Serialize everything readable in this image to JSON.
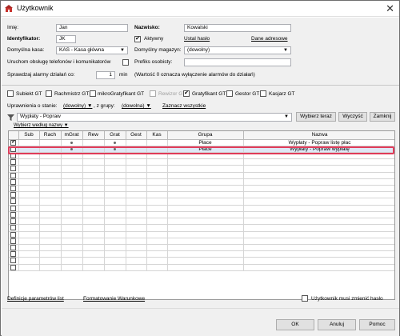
{
  "window": {
    "title": "Użytkownik",
    "close_glyph": "✕"
  },
  "form": {
    "imie_label": "Imię:",
    "imie_value": "Jan",
    "nazwisko_label": "Nazwisko:",
    "nazwisko_value": "Kowalski",
    "identyfikator_label": "Identyfikator:",
    "identyfikator_value": "JK",
    "aktywny_label": "Aktywny",
    "aktywny_checked": "✔",
    "ustal_haslo": "Ustal hasło",
    "dane_adresowe": "Dane adresowe",
    "kasa_label": "Domyślna kasa:",
    "kasa_value": "KAS - Kasa główna",
    "magazyn_label": "Domyślny magazyn:",
    "magazyn_value": "(dowolny)",
    "telefony_label": "Uruchom obsługę telefonów i komunikatorów",
    "prefiks_label": "Prefiks osobisty:",
    "prefiks_value": "",
    "alarm_label": "Sprawdzaj alarmy działań co:",
    "alarm_value": "1",
    "alarm_unit": "min",
    "alarm_note": "(Wartość 0 oznacza wyłączenie alarmów do działań)"
  },
  "roles": [
    {
      "label": "Subiekt GT",
      "checked": ""
    },
    {
      "label": "Rachmistrz GT",
      "checked": ""
    },
    {
      "label": "mikroGratyfikant GT",
      "checked": ""
    },
    {
      "label": "Rewizor GT",
      "checked": ""
    },
    {
      "label": "Gratyfikant GT",
      "checked": "✔"
    },
    {
      "label": "Gestor GT",
      "checked": ""
    },
    {
      "label": "Kasjarz GT",
      "checked": ""
    }
  ],
  "perm": {
    "stan_label": "Uprawnienia o stanie:",
    "stan_value": "(dowolny)",
    "grupa_label": ", z grupy:",
    "grupa_value": "(dowolna)",
    "zaznacz": "Zaznacz wszystkie",
    "filter_value": "Wypłaty - Popraw",
    "wybierz_teraz": "Wybierz teraz",
    "wyczysc": "Wyczyść",
    "zamknij": "Zamknij",
    "wybierz_wedlug": "Wybierz według nazwy"
  },
  "grid": {
    "headers": [
      "",
      "Sub",
      "Rach",
      "mGrat",
      "Rew",
      "Grat",
      "Gest",
      "Kas",
      "Grupa",
      "Nazwa"
    ],
    "rows": [
      {
        "check": "✔",
        "grupa": "Płace",
        "nazwa": "Wypłaty - Popraw listę płac"
      },
      {
        "check": "",
        "grupa": "Płace",
        "nazwa": "Wypłaty - Popraw wypłatę"
      }
    ],
    "dot": "●"
  },
  "footer": {
    "definicje": "Definicje parametrów list",
    "formatowanie": "Formatowanie Warunkowe",
    "zmienic_haslo": "Użytkownik musi zmienić hasło",
    "ok": "OK",
    "anuluj": "Anuluj",
    "pomoc": "Pomoc"
  }
}
